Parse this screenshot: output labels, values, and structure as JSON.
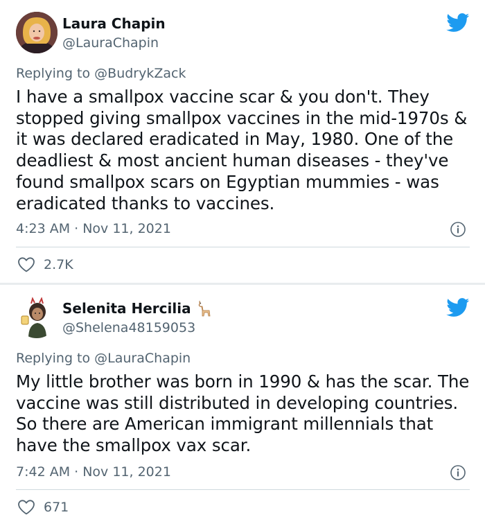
{
  "tweets": [
    {
      "display_name": "Laura Chapin",
      "handle": "@LauraChapin",
      "replying_to_prefix": "Replying to ",
      "replying_to_handle": "@BudrykZack",
      "text": "I have a smallpox vaccine scar & you don't. They stopped giving smallpox vaccines in the mid-1970s & it was declared eradicated in May, 1980. One of the deadliest & most ancient human diseases - they've found smallpox scars on Egyptian mummies - was eradicated thanks to vaccines.",
      "timestamp": "4:23 AM · Nov 11, 2021",
      "likes": "2.7K"
    },
    {
      "display_name": "Selenita Hercilia",
      "name_emoji": "llama-icon",
      "handle": "@Shelena48159053",
      "replying_to_prefix": "Replying to ",
      "replying_to_handle": "@LauraChapin",
      "text": "My little brother was born in 1990 & has the scar. The vaccine was still distributed in developing countries. So there are American immigrant millennials that have the smallpox vax scar.",
      "timestamp": "7:42 AM · Nov 11, 2021",
      "likes": "671"
    }
  ],
  "colors": {
    "twitter_blue": "#1d9bf0",
    "mention_blue": "#536471",
    "secondary_text": "#536471",
    "primary_text": "#0f1419",
    "divider": "#cfd9de"
  },
  "icons": [
    "twitter-bird-icon",
    "info-icon",
    "heart-icon",
    "llama-icon"
  ]
}
